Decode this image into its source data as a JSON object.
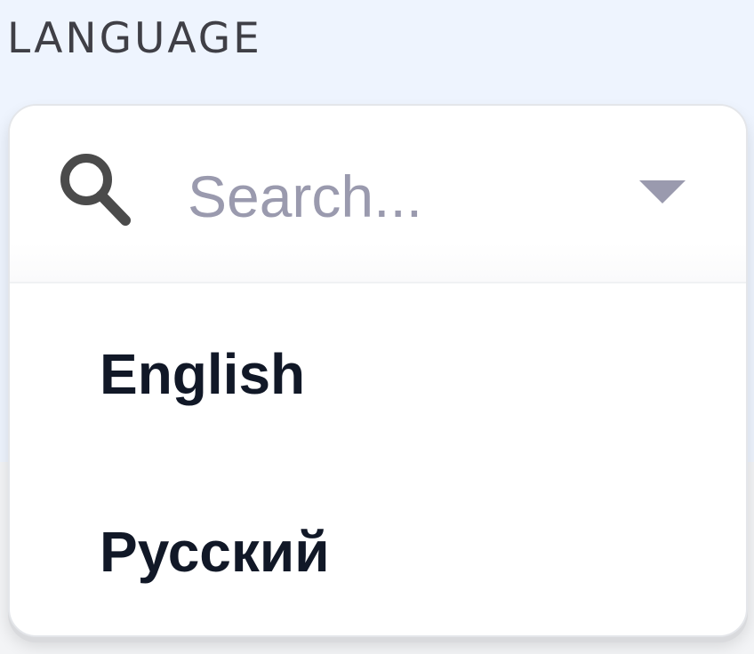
{
  "field": {
    "label": "LANGUAGE"
  },
  "dropdown": {
    "search": {
      "icon": "search-icon",
      "placeholder": "Search...",
      "value": ""
    },
    "toggle_icon": "chevron-down-icon",
    "options": [
      {
        "label": "English"
      },
      {
        "label": "Русский"
      }
    ]
  },
  "colors": {
    "page_background": "#eef4fe",
    "placeholder": "#9a9aae",
    "option_text": "#111827",
    "icon": "#4b4b4b"
  }
}
